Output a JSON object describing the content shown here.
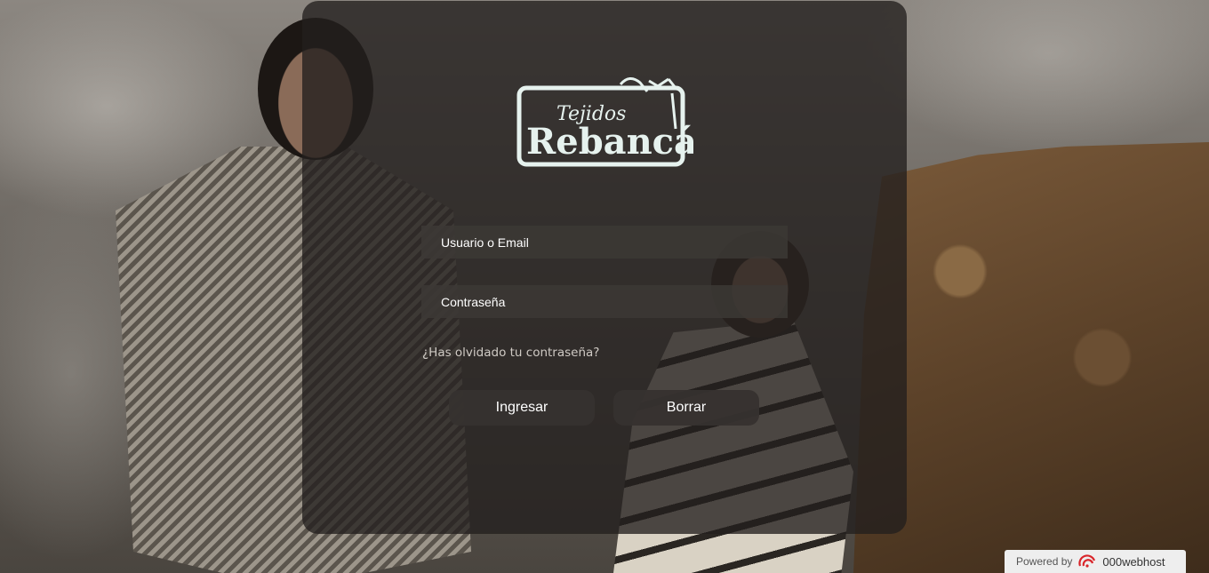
{
  "logo": {
    "line1": "Tejidos",
    "line2": "Rebancá"
  },
  "login_form": {
    "username_placeholder": "Usuario o Email",
    "password_placeholder": "Contraseña",
    "forgot_link": "¿Has olvidado tu contraseña?",
    "login_button": "Ingresar",
    "clear_button": "Borrar"
  },
  "footer": {
    "powered_by": "Powered by",
    "host_name": "000webhost",
    "host_icon": "000webhost-logo-icon"
  },
  "colors": {
    "panel_overlay": "#221f1d",
    "logo_ink": "#e6f2ee",
    "host_accent": "#d9252a"
  }
}
